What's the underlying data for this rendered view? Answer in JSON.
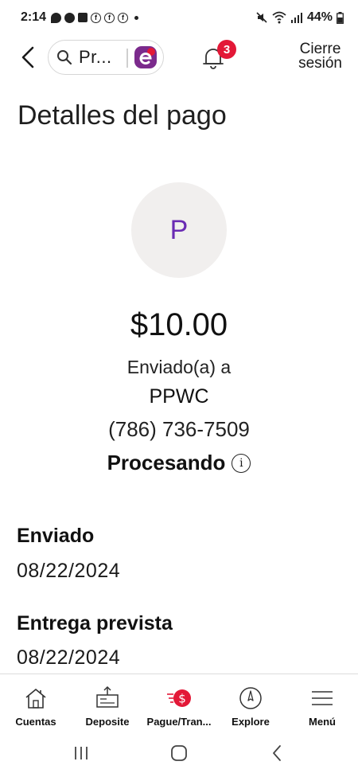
{
  "status_bar": {
    "time": "2:14",
    "battery": "44%"
  },
  "header": {
    "search_text": "Pr...",
    "notifications_count": "3",
    "logout_line1": "Cierre",
    "logout_line2": "sesión"
  },
  "page": {
    "title": "Detalles del pago",
    "avatar_initial": "P",
    "amount": "$10.00",
    "sent_to_label": "Enviado(a) a",
    "recipient": "PPWC",
    "phone": "(786) 736-7509",
    "status": "Procesando",
    "status_info": "i"
  },
  "details": {
    "sent_label": "Enviado",
    "sent_date": "08/22/2024",
    "delivery_label": "Entrega prevista",
    "delivery_date": "08/22/2024"
  },
  "bottom_nav": {
    "items": [
      {
        "label": "Cuentas",
        "icon": "house-icon"
      },
      {
        "label": "Deposite",
        "icon": "check-deposit-icon"
      },
      {
        "label": "Pague/Tran...",
        "icon": "pay-transfer-icon"
      },
      {
        "label": "Explore",
        "icon": "compass-icon"
      },
      {
        "label": "Menú",
        "icon": "menu-icon"
      }
    ]
  },
  "colors": {
    "accent_red": "#e31837",
    "avatar_purple": "#6a2bb3",
    "erica_purple": "#7b2a8c"
  }
}
